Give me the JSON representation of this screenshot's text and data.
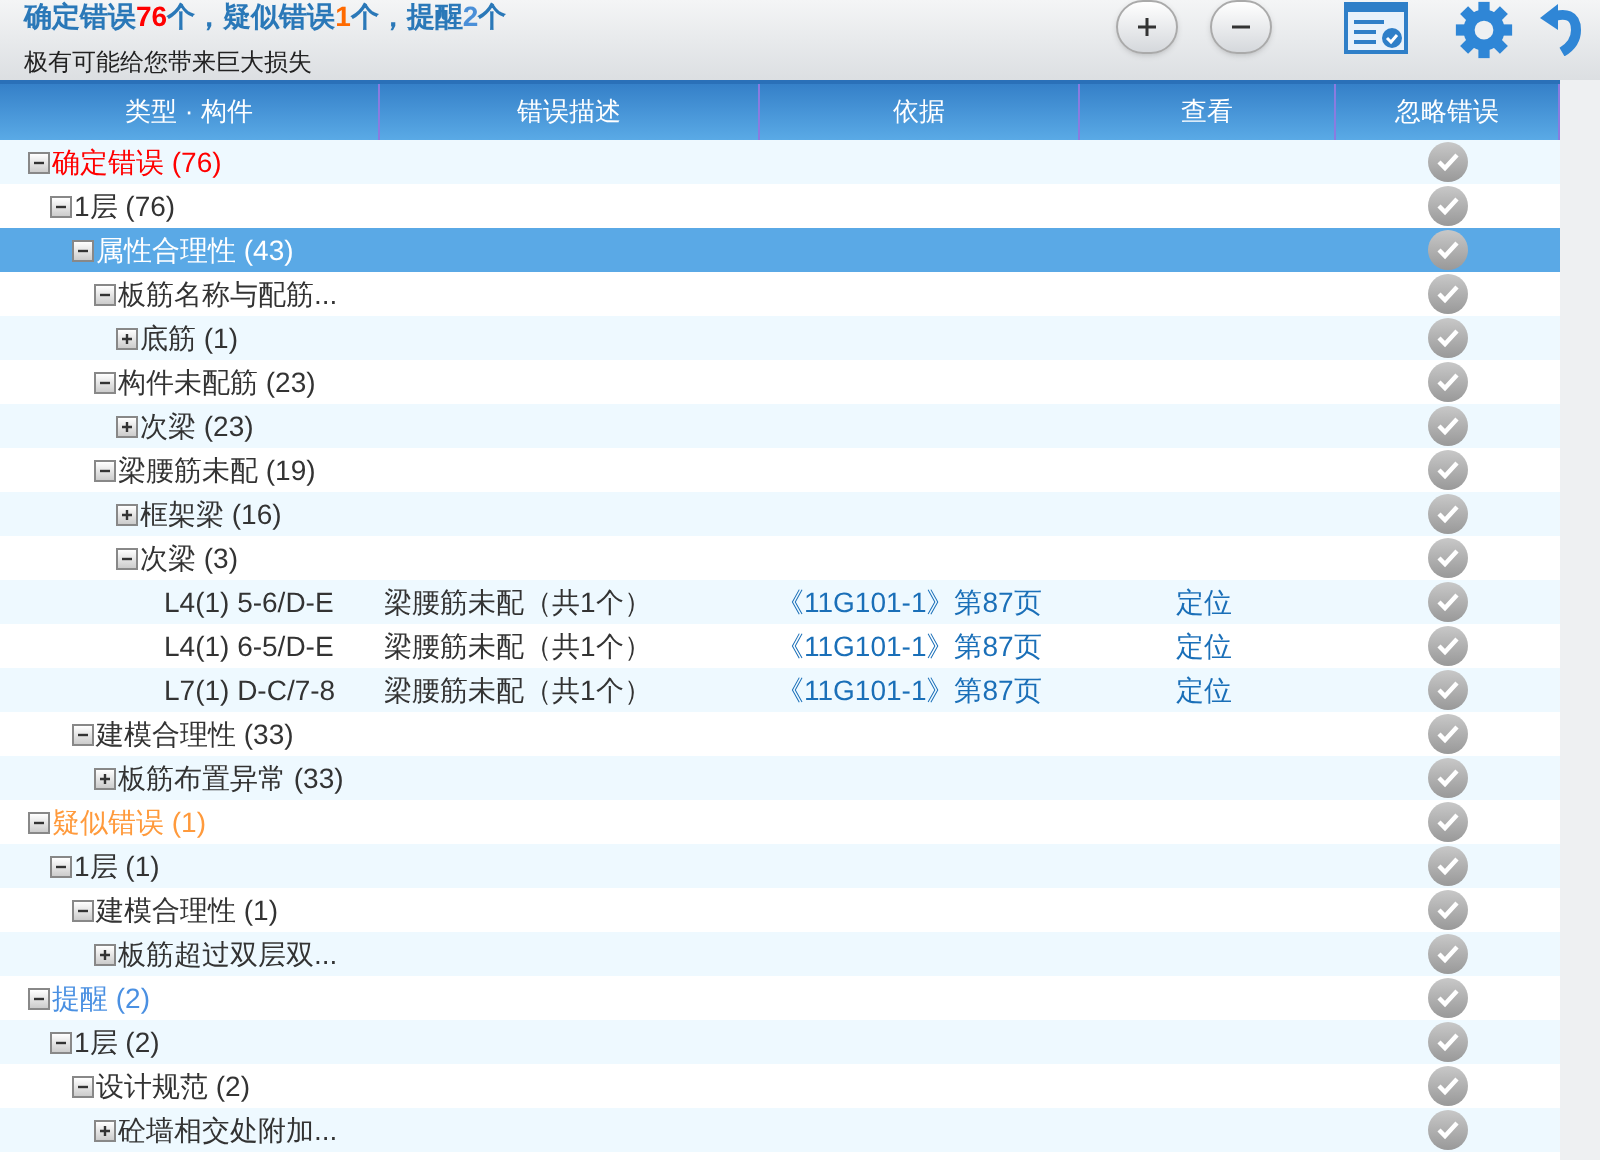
{
  "summary": [
    {
      "label": "确定错误",
      "count": "76",
      "unit": "个，",
      "color": "#ff0000"
    },
    {
      "label": "疑似错误",
      "count": "1",
      "unit": "个，",
      "color": "#ff6a00"
    },
    {
      "label": "提醒",
      "count": "2",
      "unit": "个",
      "color": "#4a8fd8"
    }
  ],
  "subtitle": "极有可能给您带来巨大损失",
  "columns": [
    "类型 · 构件",
    "错误描述",
    "依据",
    "查看",
    "忽略错误"
  ],
  "tree": [
    {
      "kind": "group",
      "label": "确定错误 (76)",
      "color": "#ff0000",
      "expanded": true,
      "selected": false,
      "children": [
        {
          "kind": "group",
          "label": "1层 (76)",
          "expanded": true,
          "selected": false,
          "children": [
            {
              "kind": "group",
              "label": "属性合理性 (43)",
              "expanded": true,
              "selected": true,
              "children": [
                {
                  "kind": "group",
                  "label": "板筋名称与配筋...",
                  "expanded": true,
                  "selected": false,
                  "children": [
                    {
                      "kind": "group",
                      "label": "底筋 (1)",
                      "expanded": false,
                      "selected": false
                    }
                  ]
                },
                {
                  "kind": "group",
                  "label": "构件未配筋 (23)",
                  "expanded": true,
                  "selected": false,
                  "children": [
                    {
                      "kind": "group",
                      "label": "次梁 (23)",
                      "expanded": false,
                      "selected": false
                    }
                  ]
                },
                {
                  "kind": "group",
                  "label": "梁腰筋未配 (19)",
                  "expanded": true,
                  "selected": false,
                  "children": [
                    {
                      "kind": "group",
                      "label": "框架梁 (16)",
                      "expanded": false,
                      "selected": false
                    },
                    {
                      "kind": "group",
                      "label": "次梁 (3)",
                      "expanded": true,
                      "selected": false,
                      "children": [
                        {
                          "kind": "issue",
                          "code": "L4(1) 5-6/D-E",
                          "description": "梁腰筋未配（共1个）",
                          "basis": "《11G101-1》第87页",
                          "action": "定位",
                          "selected": false
                        },
                        {
                          "kind": "issue",
                          "code": "L4(1) 6-5/D-E",
                          "description": "梁腰筋未配（共1个）",
                          "basis": "《11G101-1》第87页",
                          "action": "定位",
                          "selected": false
                        },
                        {
                          "kind": "issue",
                          "code": "L7(1) D-C/7-8",
                          "description": "梁腰筋未配（共1个）",
                          "basis": "《11G101-1》第87页",
                          "action": "定位",
                          "selected": false
                        }
                      ]
                    }
                  ]
                }
              ]
            },
            {
              "kind": "group",
              "label": "建模合理性 (33)",
              "expanded": true,
              "selected": false,
              "children": [
                {
                  "kind": "group",
                  "label": "板筋布置异常 (33)",
                  "expanded": false,
                  "selected": false
                }
              ]
            }
          ]
        }
      ]
    },
    {
      "kind": "group",
      "label": "疑似错误 (1)",
      "color": "#ff9a3c",
      "expanded": true,
      "selected": false,
      "children": [
        {
          "kind": "group",
          "label": "1层 (1)",
          "expanded": true,
          "selected": false,
          "children": [
            {
              "kind": "group",
              "label": "建模合理性 (1)",
              "expanded": true,
              "selected": false,
              "children": [
                {
                  "kind": "group",
                  "label": "板筋超过双层双...",
                  "expanded": false,
                  "selected": false
                }
              ]
            }
          ]
        }
      ]
    },
    {
      "kind": "group",
      "label": "提醒 (2)",
      "color": "#4a90e2",
      "expanded": true,
      "selected": false,
      "children": [
        {
          "kind": "group",
          "label": "1层 (2)",
          "expanded": true,
          "selected": false,
          "children": [
            {
              "kind": "group",
              "label": "设计规范 (2)",
              "expanded": true,
              "selected": false,
              "children": [
                {
                  "kind": "group",
                  "label": "砼墙相交处附加...",
                  "expanded": false,
                  "selected": false
                }
              ]
            }
          ]
        }
      ]
    }
  ]
}
